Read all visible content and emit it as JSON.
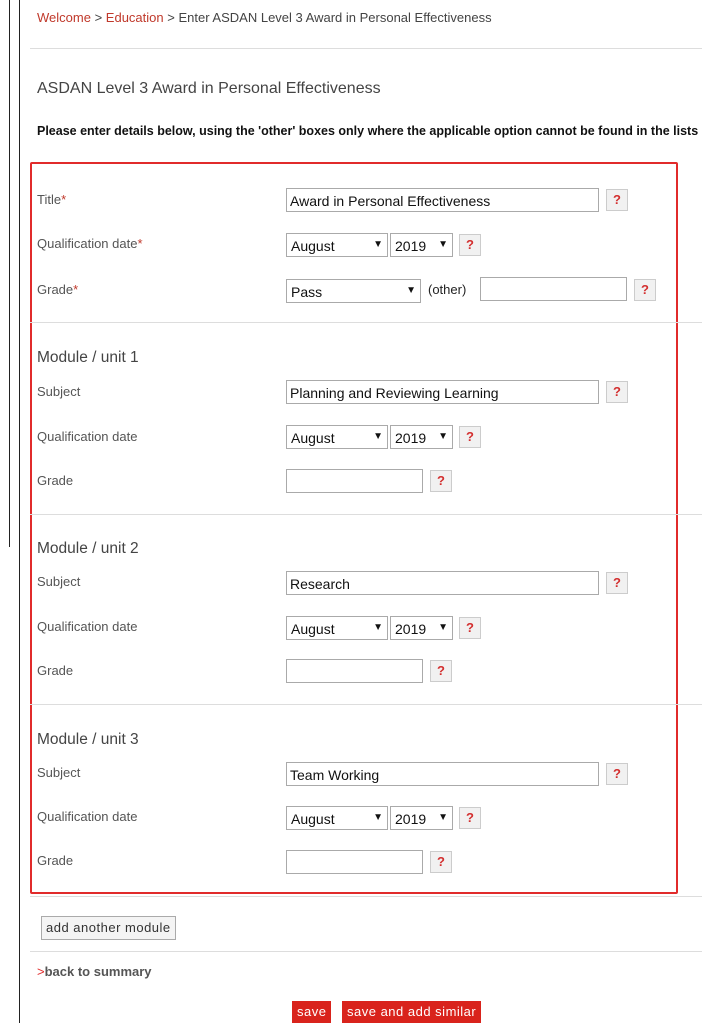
{
  "breadcrumb": {
    "home": "Welcome",
    "sep1": ">",
    "section": "Education",
    "sep2": ">",
    "current": "Enter ASDAN Level 3 Award in Personal Effectiveness"
  },
  "page_title": "ASDAN Level 3 Award in Personal Effectiveness",
  "instructions": "Please enter details below, using the 'other' boxes only where the applicable option cannot be found in the lists provided.",
  "main": {
    "title_label": "Title",
    "title_value": "Award in Personal Effectiveness",
    "qualdate_label": "Qualification date",
    "grade_label": "Grade",
    "required_marker": "*",
    "month": "August",
    "year": "2019",
    "grade_value": "Pass",
    "other_label": "(other)",
    "other_value": ""
  },
  "modules": [
    {
      "heading": "Module / unit 1",
      "subject_label": "Subject",
      "subject": "Planning and Reviewing Learning",
      "date_label": "Qualification date",
      "month": "August",
      "year": "2019",
      "grade_label": "Grade",
      "grade": ""
    },
    {
      "heading": "Module / unit 2",
      "subject_label": "Subject",
      "subject": "Research",
      "date_label": "Qualification date",
      "month": "August",
      "year": "2019",
      "grade_label": "Grade",
      "grade": ""
    },
    {
      "heading": "Module / unit 3",
      "subject_label": "Subject",
      "subject": "Team Working",
      "date_label": "Qualification date",
      "month": "August",
      "year": "2019",
      "grade_label": "Grade",
      "grade": ""
    }
  ],
  "help_glyph": "?",
  "dropdown_glyph": "▼",
  "add_module_label": "add another module",
  "back": {
    "chevron": ">",
    "label": "back to summary"
  },
  "save_label": "save",
  "save_similar_label": "save and add similar",
  "colors": {
    "accent": "#d9231c",
    "highlight_border": "#e12b2b",
    "link": "#c0392b"
  }
}
